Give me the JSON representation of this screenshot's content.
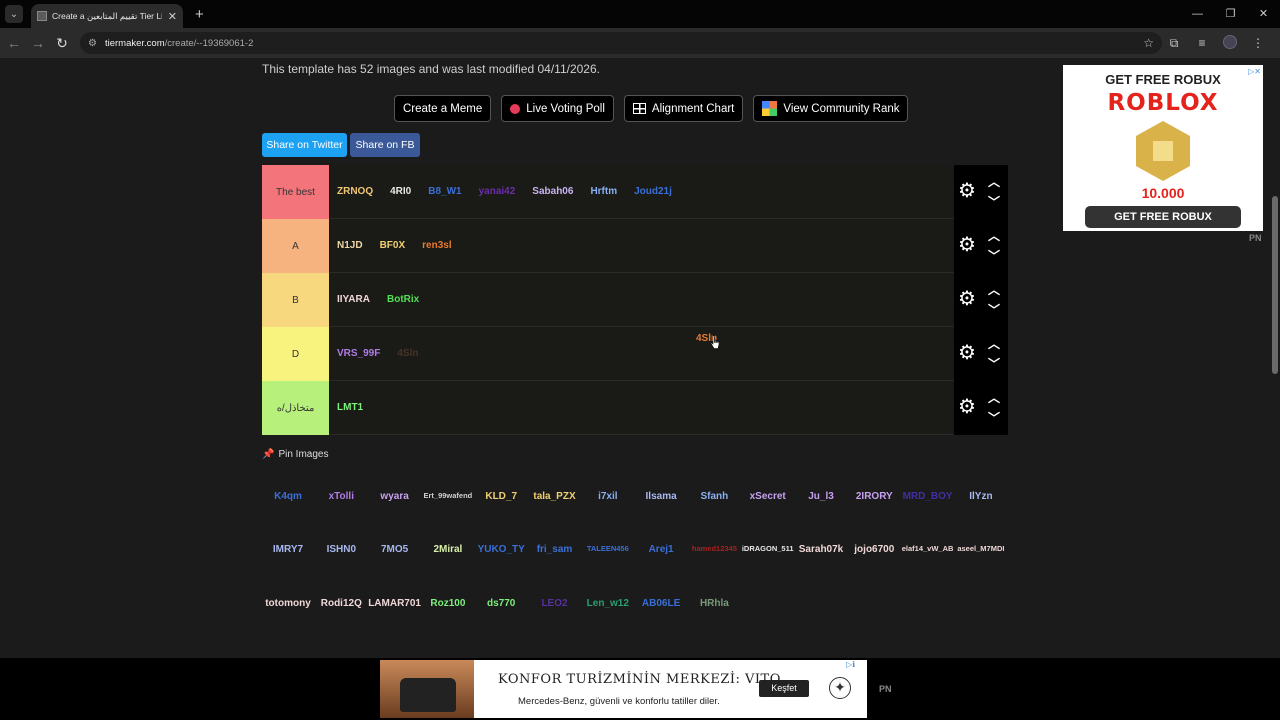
{
  "browser": {
    "tab_title": "Create a تقييم المتابعين Tier List",
    "url_host": "tiermaker.com",
    "url_path": "/create/--19369061-2"
  },
  "page": {
    "info_text": "This template has 52 images and was last modified 04/11/2026.",
    "buttons": {
      "meme": "Create a Meme",
      "poll": "Live Voting Poll",
      "alignment": "Alignment Chart",
      "community": "View Community Rank"
    },
    "share_twitter": "Share on Twitter",
    "share_fb": "Share on FB",
    "pin_label": "Pin Images"
  },
  "tiers": [
    {
      "label": "The best",
      "color": "#f4747b",
      "items": [
        {
          "t": "ZRNOQ",
          "c": "#f0c674"
        },
        {
          "t": "4RI0",
          "c": "#e8e8e8"
        },
        {
          "t": "B8_W1",
          "c": "#3a6fd8"
        },
        {
          "t": "yanai42",
          "c": "#6b2fa8"
        },
        {
          "t": "Sabah06",
          "c": "#c8b4f0"
        },
        {
          "t": "Hrftm",
          "c": "#8ab0f0"
        },
        {
          "t": "Joud21j",
          "c": "#3a6fd8"
        }
      ]
    },
    {
      "label": "A",
      "color": "#f7b37f",
      "items": [
        {
          "t": "N1JD",
          "c": "#f0d8a8"
        },
        {
          "t": "BF0X",
          "c": "#f0d070"
        },
        {
          "t": "ren3sl",
          "c": "#e87a30"
        }
      ]
    },
    {
      "label": "B",
      "color": "#f8d87e",
      "items": [
        {
          "t": "IIYARA",
          "c": "#f0d8d8"
        },
        {
          "t": "BotRix",
          "c": "#52e052"
        }
      ]
    },
    {
      "label": "D",
      "color": "#f8f27e",
      "items": [
        {
          "t": "VRS_99F",
          "c": "#b07ce8"
        },
        {
          "t": "4Sln",
          "c": "#4a3324"
        }
      ]
    },
    {
      "label": "متخاذل/ه",
      "color": "#b8f07c",
      "items": [
        {
          "t": "LMT1",
          "c": "#7cf07c"
        }
      ]
    }
  ],
  "dragging_item": {
    "t": "4Sln",
    "c": "#e67c30"
  },
  "pool_rows": [
    [
      {
        "t": "K4qm",
        "c": "#3a6fd8"
      },
      {
        "t": "xTolli",
        "c": "#b07ce8"
      },
      {
        "t": "wyara",
        "c": "#c8a0f0"
      },
      {
        "t": "Ert_99wafend",
        "c": "#cfcfcf",
        "s": true
      },
      {
        "t": "KLD_7",
        "c": "#f0d070"
      },
      {
        "t": "tala_PZX",
        "c": "#f0d070"
      },
      {
        "t": "i7xil",
        "c": "#8ab0f0"
      },
      {
        "t": "Ilsama",
        "c": "#a8b8f0"
      },
      {
        "t": "Sfanh",
        "c": "#8ab0f0"
      },
      {
        "t": "xSecret",
        "c": "#c8a0f0"
      },
      {
        "t": "Ju_l3",
        "c": "#c8a0f0"
      },
      {
        "t": "2IRORY",
        "c": "#c8a0f0"
      },
      {
        "t": "MRD_BOY",
        "c": "#4030a0"
      },
      {
        "t": "IlYzn",
        "c": "#a8b8f0"
      }
    ],
    [
      {
        "t": "IMRY7",
        "c": "#a8b8f0"
      },
      {
        "t": "ISHN0",
        "c": "#a8b8f0"
      },
      {
        "t": "7MO5",
        "c": "#a8b8f0"
      },
      {
        "t": "2Miral",
        "c": "#d8f0a8"
      },
      {
        "t": "YUKO_TY",
        "c": "#3a6fd8"
      },
      {
        "t": "fri_sam",
        "c": "#3a6fd8"
      },
      {
        "t": "TALEEN456",
        "c": "#3a6fd8",
        "s": true
      },
      {
        "t": "Arej1",
        "c": "#3a6fd8"
      },
      {
        "t": "hamed12345",
        "c": "#a82020",
        "s": true
      },
      {
        "t": "iDRAGON_511",
        "c": "#e8e8e8",
        "s": true
      },
      {
        "t": "Sarah07k",
        "c": "#f0d8d8"
      },
      {
        "t": "jojo6700",
        "c": "#f0d8d8"
      },
      {
        "t": "elaf14_vW_AB",
        "c": "#f0d8d8",
        "s": true
      },
      {
        "t": "aseel_M7MDI",
        "c": "#f0d8d8",
        "s": true
      }
    ],
    [
      {
        "t": "totomony",
        "c": "#f0d8d8"
      },
      {
        "t": "Rodi12Q",
        "c": "#f0d8d8"
      },
      {
        "t": "LAMAR701",
        "c": "#f0d8d8"
      },
      {
        "t": "Roz100",
        "c": "#7cf07c"
      },
      {
        "t": "ds770",
        "c": "#7cf07c"
      },
      {
        "t": "LEO2",
        "c": "#5a2fa0"
      },
      {
        "t": "Len_w12",
        "c": "#2aa070"
      },
      {
        "t": "AB06LE",
        "c": "#3a6fd8"
      },
      {
        "t": "HRhla",
        "c": "#7a9a7a"
      }
    ]
  ],
  "ads": {
    "right": {
      "heading": "GET FREE ROBUX",
      "logo": "ROBLOX",
      "amount": "10.000",
      "cta": "GET FREE ROBUX",
      "pn": "PN"
    },
    "bottom": {
      "title": "KONFOR TURİZMİNİN MERKEZİ: VITO",
      "subtitle": "Mercedes-Benz, güvenli ve konforlu tatiller diler.",
      "cta": "Keşfet",
      "pn": "PN"
    }
  }
}
